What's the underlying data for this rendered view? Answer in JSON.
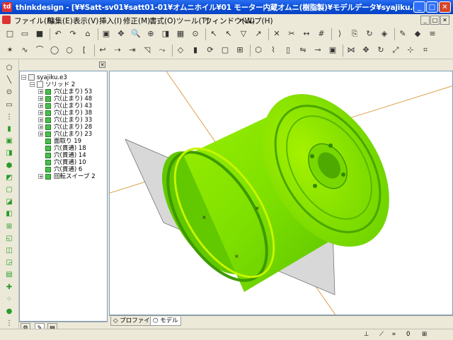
{
  "window": {
    "title": "thinkdesign  - [¥¥Satt-sv01¥satt01-01¥オムニホイル¥01 モーター内蔵オムニ(樹脂製)¥モデルデータ¥syajiku.e3]",
    "app_icon_label": "td",
    "controls": {
      "minimize": "_",
      "maximize": "□",
      "close": "✕"
    }
  },
  "menu": {
    "items": [
      "ファイル(F)",
      "編集(E)",
      "表示(V)",
      "挿入(I)",
      "修正(M)",
      "書式(O)",
      "ツール(T)",
      "ウィンドウ(W)",
      "ヘルプ(H)"
    ],
    "mdi_controls": [
      "_",
      "□",
      "✕"
    ]
  },
  "toolbar1": {
    "icons": [
      "new-doc-icon",
      "open-folder-icon",
      "save-icon",
      "undo-icon",
      "redo-icon",
      "lock-icon",
      "shaded-cube-icon",
      "pan-icon",
      "zoom-icon",
      "zoom-window-icon",
      "view-cube-icon",
      "table-icon",
      "zoom-fit-icon",
      "arrow-select-icon",
      "pick-icon",
      "funnel-icon",
      "pointer-icon",
      "delete-x-icon",
      "trim-icon",
      "extend-icon",
      "grid-icon",
      "split-icon",
      "copy-icon",
      "transform-icon",
      "paint-icon",
      "tools-icon",
      "plugin-icon",
      "layers-icon"
    ],
    "glyphs": [
      "□",
      "▭",
      "■",
      "↶",
      "↷",
      "⌂",
      "▣",
      "✥",
      "🔍",
      "⊕",
      "◨",
      "▦",
      "⊙",
      "↖",
      "↖",
      "▽",
      "↗",
      "✕",
      "✂",
      "↔",
      "#",
      "⟩",
      "⎘",
      "↻",
      "◈",
      "✎",
      "◆",
      "≡"
    ]
  },
  "toolbar2": {
    "icons": [
      "vertex-icon",
      "curve-icon",
      "spline-icon",
      "ellipse-icon",
      "circle-icon",
      "bracket-icon",
      "fillet-icon",
      "offset-icon",
      "blend-icon",
      "chamfer-icon",
      "sweep-icon",
      "surface-icon",
      "extrude-icon",
      "revolve-icon",
      "shell-icon",
      "boolean-icon",
      "patch-icon",
      "wire-icon",
      "cylinder-icon",
      "mirror-icon",
      "pipe-icon",
      "box-icon",
      "group-icon",
      "move-icon",
      "rotate-icon",
      "scale-icon",
      "snap-icon",
      "measure-icon"
    ],
    "glyphs": [
      "✶",
      "∿",
      "⌒",
      "◯",
      "○",
      "[",
      "↩",
      "⇢",
      "⇥",
      "◹",
      "⤳",
      "◇",
      "▮",
      "⟳",
      "▢",
      "⊞",
      "⬡",
      "⌇",
      "▯",
      "⇋",
      "⊸",
      "▣",
      "⋈",
      "✥",
      "↻",
      "⤢",
      "⊹",
      "⌗"
    ]
  },
  "vtoolbar": {
    "icons": [
      "polygon-icon",
      "line-icon",
      "circle-point-icon",
      "rectangle-icon",
      "more-icon",
      "solid-box-icon",
      "solid-extrude-icon",
      "solid-revolve-icon",
      "solid-sweep-icon",
      "solid-loft-icon",
      "solid-shell-icon",
      "solid-fillet-icon",
      "solid-chamfer-icon",
      "solid-boolean-icon",
      "solid-draft-icon",
      "solid-split-icon",
      "solid-pattern-icon",
      "solid-mirror-icon",
      "tree-icon",
      "dots-array-icon",
      "sphere-icon",
      "more-bottom-icon"
    ]
  },
  "tree": {
    "root": "syajiku.e3",
    "solid": "ソリッド 2",
    "items": [
      {
        "label": "穴(止まり) 53",
        "expandable": true
      },
      {
        "label": "穴(止まり) 48",
        "expandable": true
      },
      {
        "label": "穴(止まり) 43",
        "expandable": true
      },
      {
        "label": "穴(止まり) 38",
        "expandable": true
      },
      {
        "label": "穴(止まり) 33",
        "expandable": true
      },
      {
        "label": "穴(止まり) 28",
        "expandable": true
      },
      {
        "label": "穴(止まり) 23",
        "expandable": true
      },
      {
        "label": "面取り 19",
        "expandable": false
      },
      {
        "label": "穴(貫通) 18",
        "expandable": false
      },
      {
        "label": "穴(貫通) 14",
        "expandable": false
      },
      {
        "label": "穴(貫通) 10",
        "expandable": false
      },
      {
        "label": "穴(貫通) 6",
        "expandable": false
      },
      {
        "label": "回転スイープ 2",
        "expandable": true
      }
    ],
    "tabs_icons": [
      "gear-tab-icon",
      "pencil-tab-icon",
      "doc-tab-icon"
    ]
  },
  "viewport": {
    "tabs": [
      "プロファイル",
      "モデル"
    ],
    "active_tab": "モデル",
    "model_color": "#7ee000",
    "model_highlight": "#dff000",
    "model_shadow": "#2f8a00",
    "plane_color": "#d8d8d8",
    "axis_color": "#d9a24a"
  },
  "status": {
    "right_value": "0",
    "icons": [
      "status-link-icon",
      "status-snap-icon",
      "status-grid-icon",
      "status-units-icon"
    ]
  }
}
